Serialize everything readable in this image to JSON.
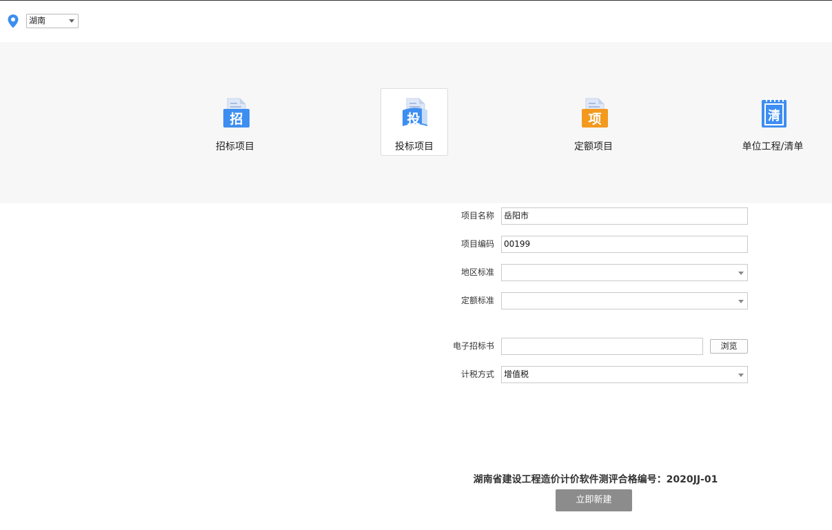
{
  "region": {
    "icon": "location-pin-icon",
    "selected": "湖南",
    "accent": "#3d8ef0"
  },
  "project_types": [
    {
      "label": "招标项目",
      "icon_text": "招",
      "icon": "tender-document-icon",
      "color": "#3d8ef0",
      "selected": false
    },
    {
      "label": "投标项目",
      "icon_text": "投",
      "icon": "bid-document-icon",
      "color": "#3d8ef0",
      "selected": true
    },
    {
      "label": "定额项目",
      "icon_text": "项",
      "icon": "quota-document-icon",
      "color": "#f39a1e",
      "selected": false
    },
    {
      "label": "单位工程/清单",
      "icon_text": "清",
      "icon": "bill-notebook-icon",
      "color": "#3d8ef0",
      "selected": false
    }
  ],
  "form": {
    "project_name_label": "项目名称",
    "project_name_value": "岳阳市",
    "project_code_label": "项目编码",
    "project_code_value": "00199",
    "region_standard_label": "地区标准",
    "region_standard_value": "",
    "quota_standard_label": "定额标准",
    "quota_standard_value": "",
    "tender_file_label": "电子招标书",
    "tender_file_value": "",
    "browse_label": "浏览",
    "tax_method_label": "计税方式",
    "tax_method_value": "增值税"
  },
  "footer": {
    "certificate": "湖南省建设工程造价计价软件测评合格编号：2020JJ-01",
    "create_label": "立即新建"
  }
}
